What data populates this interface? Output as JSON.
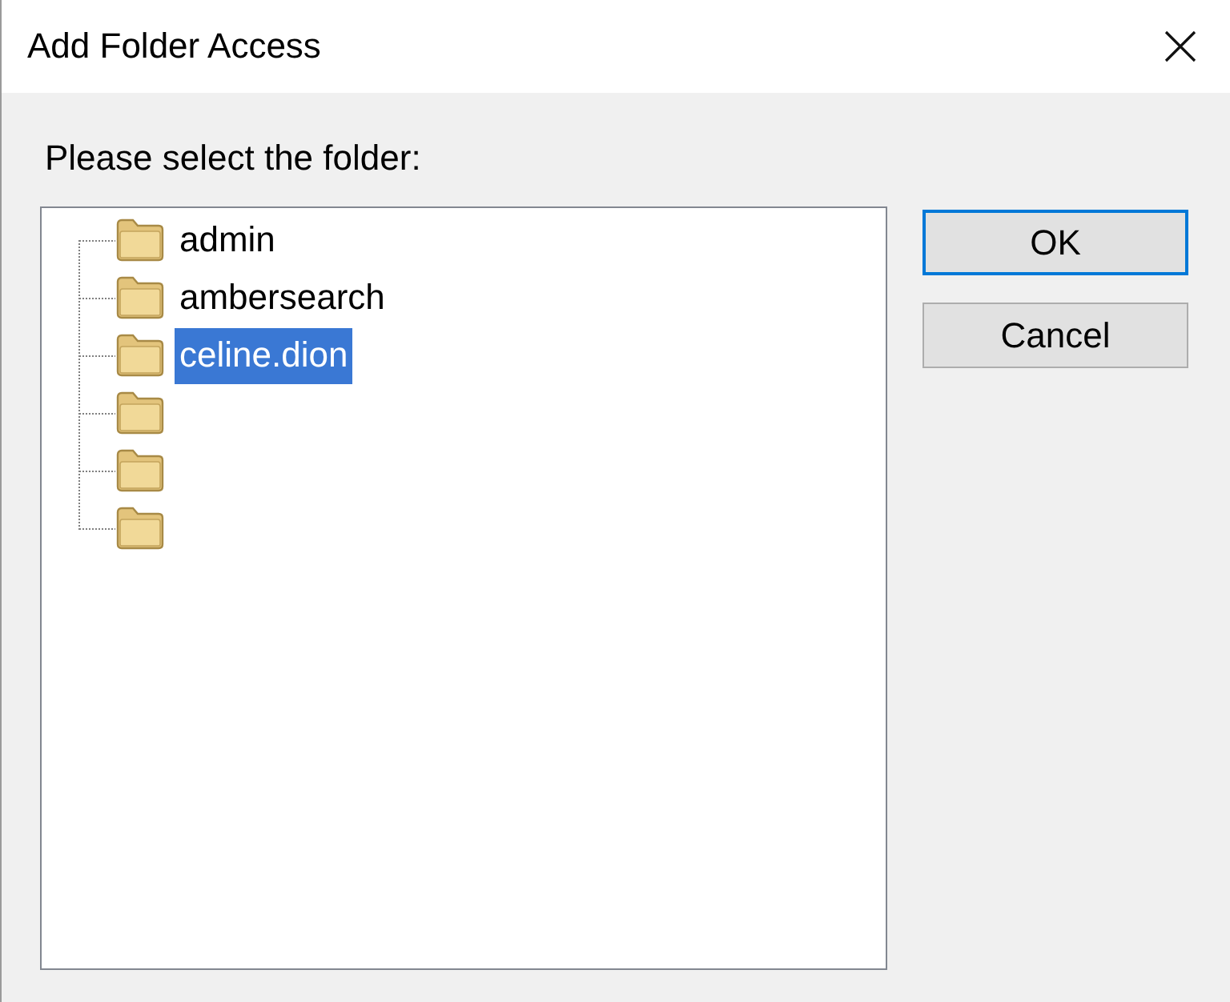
{
  "window": {
    "title": "Add Folder Access"
  },
  "prompt": "Please select the folder:",
  "tree": {
    "items": [
      {
        "label": "admin",
        "selected": false
      },
      {
        "label": "ambersearch",
        "selected": false
      },
      {
        "label": "celine.dion",
        "selected": true
      },
      {
        "selected": false
      },
      {
        "selected": false
      },
      {
        "selected": false
      }
    ]
  },
  "buttons": [
    {
      "label": "OK",
      "default": true
    },
    {
      "label": "Cancel",
      "default": false
    }
  ]
}
